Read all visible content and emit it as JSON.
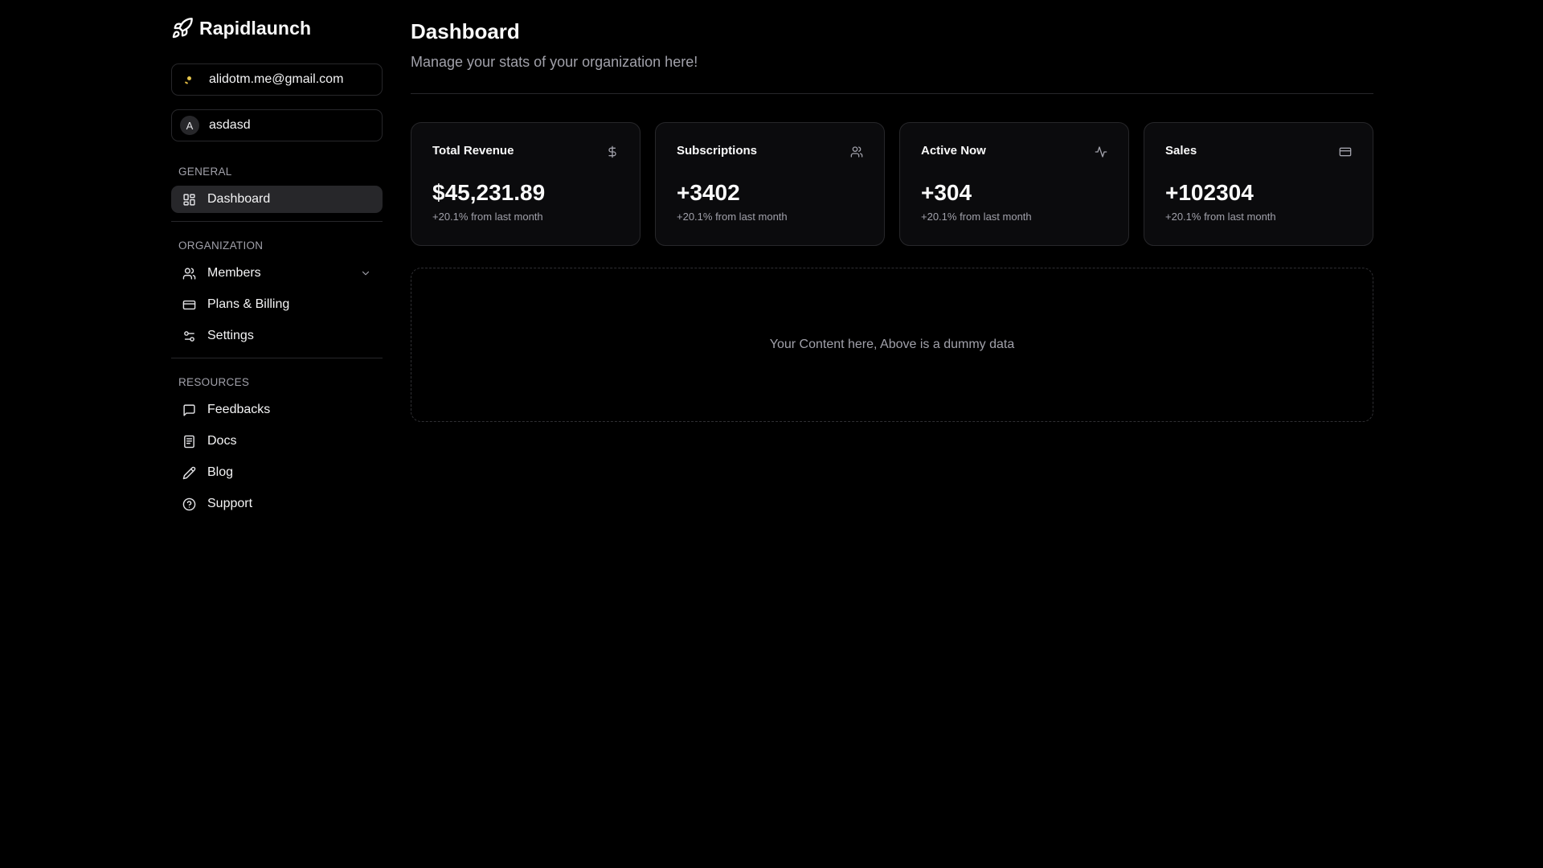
{
  "brand": {
    "name": "Rapidlaunch"
  },
  "account": {
    "email": "alidotm.me@gmail.com"
  },
  "organization": {
    "initial": "A",
    "name": "asdasd"
  },
  "sidebar": {
    "general_label": "GENERAL",
    "general_items": [
      {
        "label": "Dashboard",
        "icon": "dashboard-icon"
      }
    ],
    "organization_label": "ORGANIZATION",
    "organization_items": [
      {
        "label": "Members",
        "icon": "users-icon"
      },
      {
        "label": "Plans & Billing",
        "icon": "credit-card-icon"
      },
      {
        "label": "Settings",
        "icon": "settings-sliders-icon"
      }
    ],
    "resources_label": "RESOURCES",
    "resources_items": [
      {
        "label": "Feedbacks",
        "icon": "message-icon"
      },
      {
        "label": "Docs",
        "icon": "docs-icon"
      },
      {
        "label": "Blog",
        "icon": "pencil-icon"
      },
      {
        "label": "Support",
        "icon": "help-circle-icon"
      }
    ]
  },
  "header": {
    "title": "Dashboard",
    "subtitle": "Manage your stats of your organization here!"
  },
  "stats": [
    {
      "title": "Total Revenue",
      "value": "$45,231.89",
      "note": "+20.1% from last month",
      "icon": "dollar-icon"
    },
    {
      "title": "Subscriptions",
      "value": "+3402",
      "note": "+20.1% from last month",
      "icon": "users-icon"
    },
    {
      "title": "Active Now",
      "value": "+304",
      "note": "+20.1% from last month",
      "icon": "activity-icon"
    },
    {
      "title": "Sales",
      "value": "+102304",
      "note": "+20.1% from last month",
      "icon": "credit-card-icon"
    }
  ],
  "content": {
    "placeholder": "Your Content here, Above is a dummy data"
  },
  "colors": {
    "background": "#000000",
    "border": "#27272a",
    "muted": "#a1a1aa",
    "active": "#27272a"
  }
}
